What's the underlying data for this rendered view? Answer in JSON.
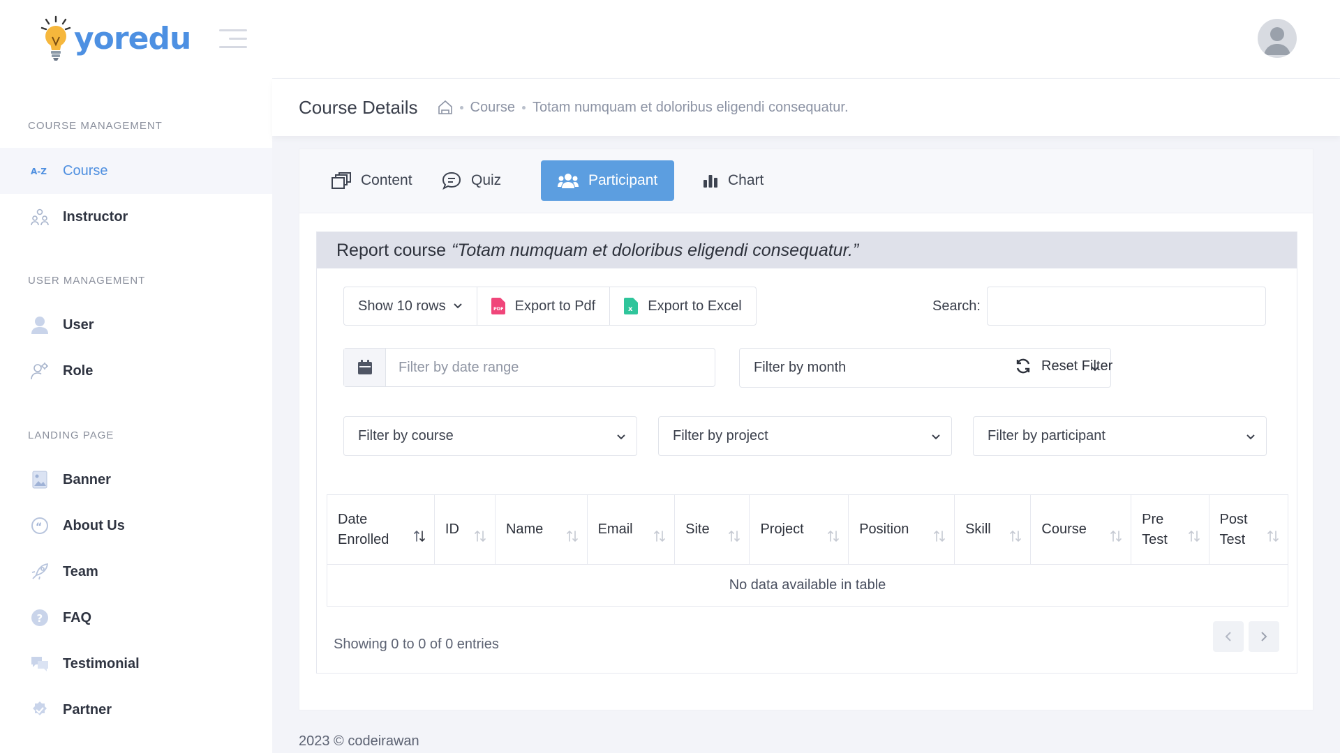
{
  "app": {
    "logo_text": "yoredu"
  },
  "sidebar": {
    "sections": [
      {
        "title": "COURSE MANAGEMENT",
        "items": [
          {
            "label": "Course",
            "icon": "az-icon",
            "active": true
          },
          {
            "label": "Instructor",
            "icon": "people-icon"
          }
        ]
      },
      {
        "title": "USER MANAGEMENT",
        "items": [
          {
            "label": "User",
            "icon": "user-icon"
          },
          {
            "label": "Role",
            "icon": "user-cog-icon"
          }
        ]
      },
      {
        "title": "LANDING PAGE",
        "items": [
          {
            "label": "Banner",
            "icon": "image-icon"
          },
          {
            "label": "About Us",
            "icon": "quote-icon"
          },
          {
            "label": "Team",
            "icon": "rocket-icon"
          },
          {
            "label": "FAQ",
            "icon": "question-icon"
          },
          {
            "label": "Testimonial",
            "icon": "chat-icon"
          },
          {
            "label": "Partner",
            "icon": "badge-check-icon"
          }
        ]
      }
    ]
  },
  "header": {
    "page_title": "Course Details",
    "breadcrumb": [
      "Course",
      "Totam numquam et doloribus eligendi consequatur."
    ]
  },
  "tabs": [
    {
      "label": "Content",
      "icon": "copy-icon"
    },
    {
      "label": "Quiz",
      "icon": "comment-icon"
    },
    {
      "label": "Participant",
      "icon": "users-icon",
      "active": true
    },
    {
      "label": "Chart",
      "icon": "bar-chart-icon"
    }
  ],
  "report": {
    "title_prefix": "Report course",
    "course_name": "“Totam numquam et doloribus eligendi consequatur.”",
    "show_rows": "Show 10 rows",
    "export_pdf": "Export to Pdf",
    "export_excel": "Export to Excel",
    "search_label": "Search:",
    "search_value": "",
    "date_placeholder": "Filter by date range",
    "filter_month": "Filter by month",
    "reset_filter": "Reset Filter",
    "filter_course": "Filter by course",
    "filter_project": "Filter by project",
    "filter_participant": "Filter by participant",
    "columns": [
      [
        "Date",
        "Enrolled"
      ],
      [
        "ID"
      ],
      [
        "Name"
      ],
      [
        "Email"
      ],
      [
        "Site"
      ],
      [
        "Project"
      ],
      [
        "Position"
      ],
      [
        "Skill"
      ],
      [
        "Course"
      ],
      [
        "Pre",
        "Test"
      ],
      [
        "Post",
        "Test"
      ]
    ],
    "empty_message": "No data available in table",
    "showing": "Showing 0 to 0 of 0 entries"
  },
  "footer": {
    "text": "2023  © codeirawan"
  },
  "colors": {
    "accent": "#5c9ee0",
    "link": "#4e8fe0",
    "logo": "#4d90e2"
  }
}
